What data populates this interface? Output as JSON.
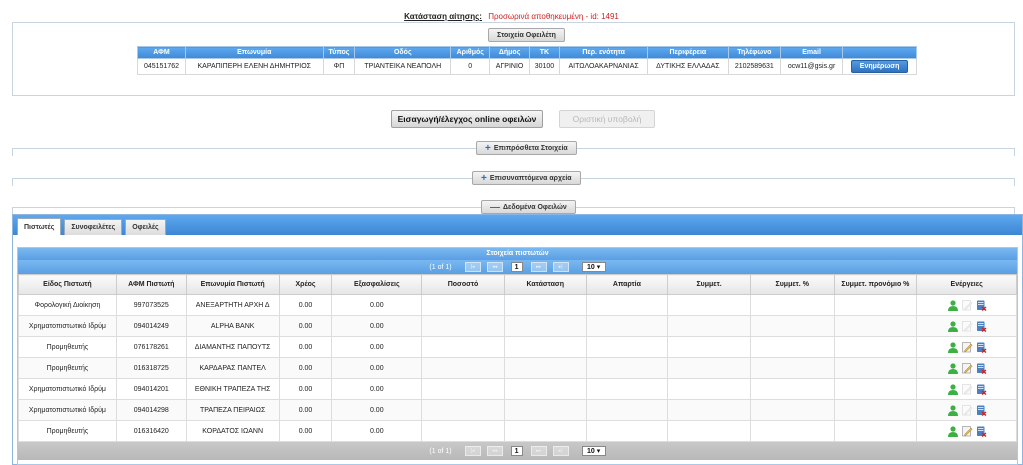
{
  "status": {
    "label": "Κατάσταση αίτησης:",
    "value": "Προσωρινά αποθηκευμένη - id: 1491"
  },
  "debtor": {
    "section_title": "Στοιχεία Οφειλέτη",
    "columns": [
      "ΑΦΜ",
      "Επωνυμία",
      "Τύπος",
      "Οδός",
      "Αριθμός",
      "Δήμος",
      "ΤΚ",
      "Περ. ενότητα",
      "Περιφέρεια",
      "Τηλέφωνο",
      "Email",
      ""
    ],
    "row": [
      "045151762",
      "ΚΑΡΑΠΙΠΕΡΗ ΕΛΕΝΗ ΔΗΜΗΤΡΙΟΣ",
      "ΦΠ",
      "ΤΡΙΑΝΤΕΙΚΑ ΝΕΑΠΟΛΗ",
      "0",
      "ΑΓΡΙΝΙΟ",
      "30100",
      "ΑΙΤΩΛΟΑΚΑΡΝΑΝΙΑΣ",
      "ΔΥΤΙΚΗΣ ΕΛΛΑΔΑΣ",
      "2102589631",
      "ocw11@gsis.gr"
    ],
    "update_label": "Ενημέρωση"
  },
  "actions": {
    "online_debts": "Εισαγωγή/έλεγχος online οφειλών",
    "final_submit": "Οριστική υποβολή"
  },
  "sections": {
    "additional": "Επιπρόσθετα Στοιχεία",
    "attachments": "Επισυναπτόμενα αρχεία",
    "debt_data": "Δεδομένα Οφειλών",
    "plus_sign": "+",
    "minus_sign": "—"
  },
  "tabs": [
    "Πιστωτές",
    "Συνοφειλέτες",
    "Οφειλές"
  ],
  "creditors": {
    "title": "Στοιχεία πιστωτών",
    "paginator": {
      "info": "(1 of 1)",
      "page": "1",
      "rows": "10 ▾",
      "first": "|◂",
      "prev": "◂◂",
      "next": "▸▸",
      "last": "▸|"
    },
    "columns": [
      "Είδος Πιστωτή",
      "ΑΦΜ Πιστωτή",
      "Επωνυμία Πιστωτή",
      "Χρέος",
      "Εξασφαλίσεις",
      "Ποσοστό",
      "Κατάσταση",
      "Απαρτία",
      "Συμμετ.",
      "Συμμετ. %",
      "Συμμετ. προνόμιο %",
      "Ενέργειες"
    ],
    "rows": [
      [
        "Φορολογική Διοίκηση",
        "997073525",
        "ΑΝΕΞΑΡΤΗΤΗ ΑΡΧΗ Δ",
        "0.00",
        "0.00",
        "",
        "",
        "",
        "",
        "",
        ""
      ],
      [
        "Χρηματοπιστωτικό Ιδρύμ",
        "094014249",
        "ALPHA BANK",
        "0.00",
        "0.00",
        "",
        "",
        "",
        "",
        "",
        ""
      ],
      [
        "Προμηθευτής",
        "076178261",
        "ΔΙΑΜΑΝΤΗΣ ΠΑΠΟΥΤΣ",
        "0.00",
        "0.00",
        "",
        "",
        "",
        "",
        "",
        ""
      ],
      [
        "Προμηθευτής",
        "016318725",
        "ΚΑΡΔΑΡΑΣ ΠΑΝΤΕΛ",
        "0.00",
        "0.00",
        "",
        "",
        "",
        "",
        "",
        ""
      ],
      [
        "Χρηματοπιστωτικό Ιδρύμ",
        "094014201",
        "ΕΘΝΙΚΗ ΤΡΑΠΕΖΑ ΤΗΣ",
        "0.00",
        "0.00",
        "",
        "",
        "",
        "",
        "",
        ""
      ],
      [
        "Χρηματοπιστωτικό Ιδρύμ",
        "094014298",
        "ΤΡΑΠΕΖΑ ΠΕΙΡΑΙΩΣ",
        "0.00",
        "0.00",
        "",
        "",
        "",
        "",
        "",
        ""
      ],
      [
        "Προμηθευτής",
        "016316420",
        "ΚΟΡΔΑΤΟΣ ΙΩΑΝΝ",
        "0.00",
        "0.00",
        "",
        "",
        "",
        "",
        "",
        ""
      ]
    ],
    "row_actions": [
      [
        "user-icon",
        "edit-disabled-icon",
        "delete-icon"
      ],
      [
        "user-icon",
        "edit-disabled-icon",
        "delete-icon"
      ],
      [
        "user-icon",
        "edit-icon",
        "delete-icon"
      ],
      [
        "user-icon",
        "edit-icon",
        "delete-icon"
      ],
      [
        "user-icon",
        "edit-disabled-icon",
        "delete-icon"
      ],
      [
        "user-icon",
        "edit-disabled-icon",
        "delete-icon"
      ],
      [
        "user-icon",
        "edit-icon",
        "delete-icon"
      ]
    ]
  },
  "colors": {
    "accent_blue": "#3f89d8",
    "status_red": "#d42020",
    "user_green": "#3cb043",
    "delete_blue": "#4a7fc0"
  }
}
